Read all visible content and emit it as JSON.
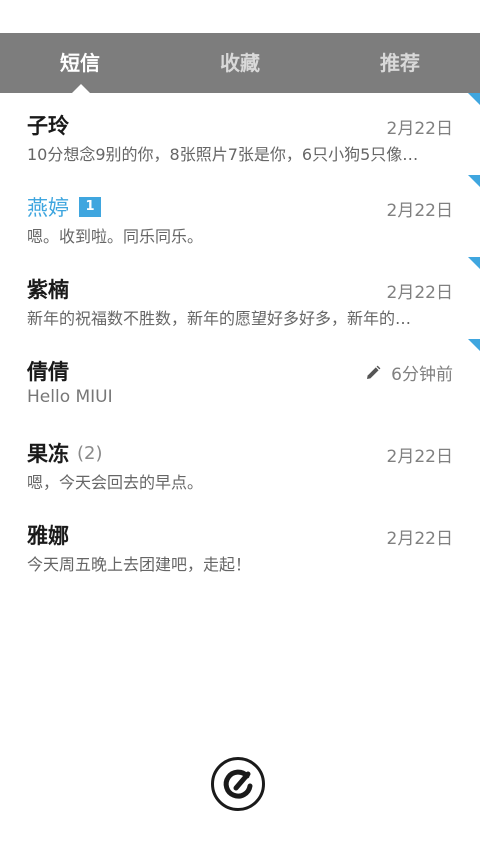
{
  "tabs": {
    "sms": "短信",
    "favorites": "收藏",
    "recommend": "推荐"
  },
  "conversations": [
    {
      "name": "子玲",
      "date": "2月22日",
      "preview": "10分想念9别的你，8张照片7张是你，6只小狗5只像…"
    },
    {
      "name": "燕婷",
      "badge": "1",
      "date": "2月22日",
      "preview": "嗯。收到啦。同乐同乐。"
    },
    {
      "name": "紫楠",
      "date": "2月22日",
      "preview": "新年的祝福数不胜数，新年的愿望好多好多，新年的…"
    },
    {
      "name": "倩倩",
      "date": "6分钟前",
      "preview": "Hello MIUI"
    },
    {
      "name": "果冻",
      "count": "(2)",
      "date": "2月22日",
      "preview": "嗯，今天会回去的早点。"
    },
    {
      "name": "雅娜",
      "date": "2月22日",
      "preview": "今天周五晚上去团建吧，走起！"
    }
  ],
  "colors": {
    "accent": "#3fa6df",
    "tabbar": "#7d7d7d"
  },
  "icons": {
    "draft": "pencil-icon",
    "compose": "compose-icon"
  }
}
